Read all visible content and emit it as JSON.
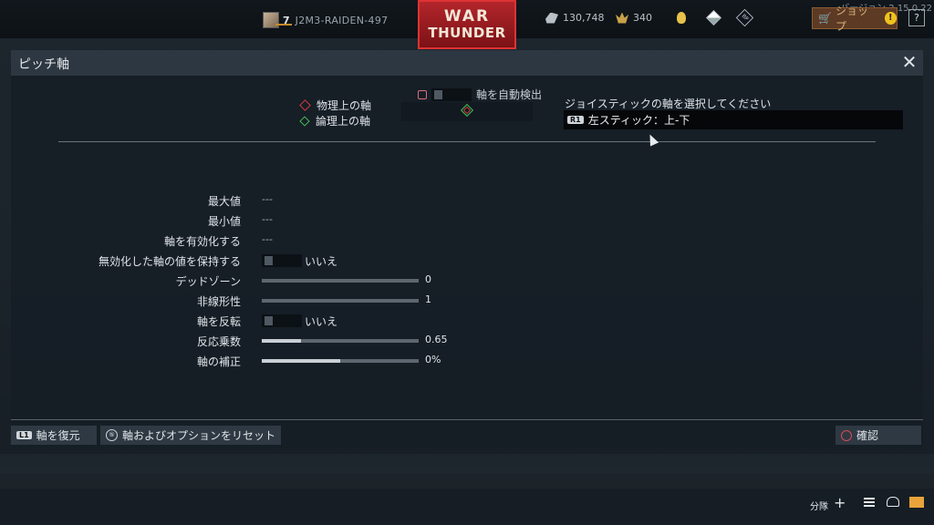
{
  "topbar": {
    "version": "バージョン 2.15.0.22",
    "rank": "7",
    "player_name": "J2M3-RAIDEN-497",
    "logo_line1": "WAR",
    "logo_line2": "THUNDER",
    "silver": "130,748",
    "eagles": "340",
    "shop_label": "ショップ",
    "help_label": "?"
  },
  "dialog": {
    "title": "ピッチ軸",
    "close_label": "✕",
    "legend_physical": "物理上の軸",
    "legend_logical": "論理上の軸",
    "autodetect_label": "軸を自動検出",
    "select_label": "ジョイスティックの軸を選択してください",
    "selected_button": "R1",
    "selected_axis": "左スティック：上-下",
    "rows": {
      "max_label": "最大値",
      "max_value": "---",
      "min_label": "最小値",
      "min_value": "---",
      "enable_label": "軸を有効化する",
      "enable_value": "---",
      "keep_label": "無効化した軸の値を保持する",
      "keep_value": "いいえ",
      "deadzone_label": "デッドゾーン",
      "deadzone_value": "0",
      "deadzone_fraction": 0,
      "nonlin_label": "非線形性",
      "nonlin_value": "1",
      "nonlin_fraction": 0,
      "invert_label": "軸を反転",
      "invert_value": "いいえ",
      "mult_label": "反応乗数",
      "mult_value": "0.65",
      "mult_fraction": 0.25,
      "corr_label": "軸の補正",
      "corr_value": "0%",
      "corr_fraction": 0.5
    },
    "footer": {
      "restore_button": "L1",
      "restore_label": "軸を復元",
      "reset_button": "⑤",
      "reset_label": "軸およびオプションをリセット",
      "confirm_label": "確認"
    }
  },
  "bottombar": {
    "squad_label": "分隊",
    "plus_label": "+"
  },
  "colors": {
    "accent_red": "#d23b3b",
    "accent_green": "#3fbf57",
    "shop_orange": "#d8b07a",
    "mail_orange": "#e8a33a"
  }
}
